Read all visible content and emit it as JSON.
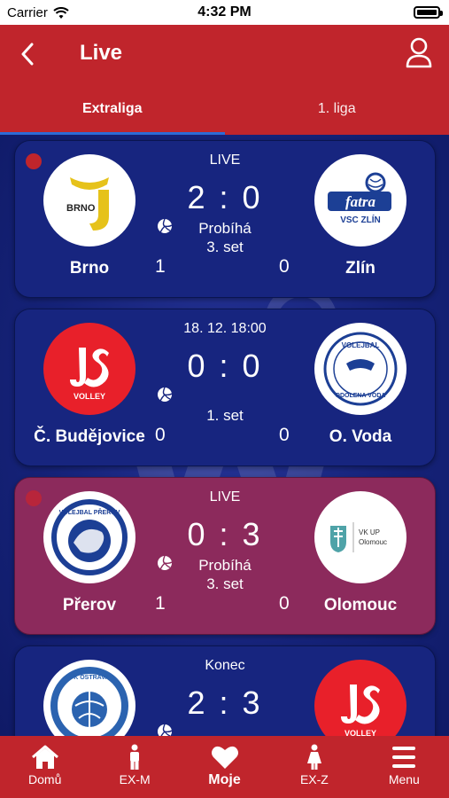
{
  "status_bar": {
    "carrier": "Carrier",
    "time": "4:32 PM"
  },
  "header": {
    "title": "Live"
  },
  "tabs": [
    {
      "label": "Extraliga",
      "active": true
    },
    {
      "label": "1. liga",
      "active": false
    }
  ],
  "matches": [
    {
      "status": "LIVE",
      "live": true,
      "highlight": false,
      "score": "2 : 0",
      "phase": "Probíhá",
      "set": "3. set",
      "home": {
        "name": "Brno",
        "set_points": "1",
        "logo": "brno-logo",
        "logo_text": "BRNO"
      },
      "away": {
        "name": "Zlín",
        "set_points": "0",
        "logo": "fatra-zlin-logo",
        "logo_text": "fatra",
        "logo_subtext": "VSC ZLÍN"
      }
    },
    {
      "status": "18. 12. 18:00",
      "live": false,
      "highlight": false,
      "score": "0 : 0",
      "phase": "",
      "set": "1. set",
      "home": {
        "name": "Č. Budějovice",
        "set_points": "0",
        "logo": "js-volley-logo",
        "logo_text": "VOLLEY"
      },
      "away": {
        "name": "O. Voda",
        "set_points": "0",
        "logo": "odolena-voda-logo",
        "logo_text": "VOLEJBAL",
        "logo_subtext": "ODOLENA VODA"
      }
    },
    {
      "status": "LIVE",
      "live": true,
      "highlight": true,
      "score": "0 : 3",
      "phase": "Probíhá",
      "set": "3. set",
      "home": {
        "name": "Přerov",
        "set_points": "1",
        "logo": "volejbal-prerov-logo",
        "logo_text": "VOLEJBAL PŘEROV"
      },
      "away": {
        "name": "Olomouc",
        "set_points": "0",
        "logo": "vk-up-olomouc-logo",
        "logo_text": "VK UP",
        "logo_subtext": "Olomouc"
      }
    },
    {
      "status": "Konec",
      "live": false,
      "highlight": false,
      "score": "2 : 3",
      "phase": "",
      "set": "",
      "home": {
        "name": "",
        "set_points": "",
        "logo": "vk-ostrava-logo",
        "logo_text": "VK OSTRAVA"
      },
      "away": {
        "name": "",
        "set_points": "",
        "logo": "js-volley-logo",
        "logo_text": "VOLLEY"
      }
    }
  ],
  "nav": [
    {
      "label": "Domů",
      "icon": "home-icon",
      "active": false
    },
    {
      "label": "EX-M",
      "icon": "man-icon",
      "active": false
    },
    {
      "label": "Moje",
      "icon": "heart-icon",
      "active": true
    },
    {
      "label": "EX-Z",
      "icon": "woman-icon",
      "active": false
    },
    {
      "label": "Menu",
      "icon": "menu-icon",
      "active": false
    }
  ],
  "colors": {
    "brand_red": "#c0252c",
    "card_blue": "#17257f",
    "card_red": "#8c2a5c",
    "tab_indicator": "#2d6bd6"
  }
}
